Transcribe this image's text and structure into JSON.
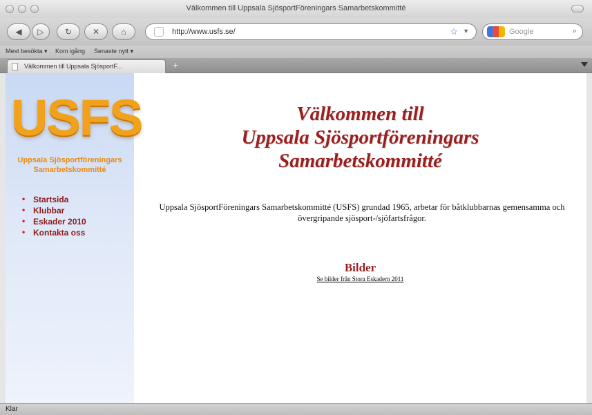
{
  "window": {
    "title": "Välkommen till Uppsala SjösportFöreningars Samarbetskommitté"
  },
  "toolbar": {
    "back_icon": "back-arrow-icon",
    "forward_icon": "forward-arrow-icon",
    "reload_icon": "reload-icon",
    "stop_icon": "stop-icon",
    "home_icon": "home-icon",
    "url": "http://www.usfs.se/",
    "search_placeholder": "Google"
  },
  "bookmarks": {
    "items": [
      "Mest besökta ▾",
      "Kom igång",
      "Senaste nytt ▾"
    ]
  },
  "tabs": [
    {
      "label": "Välkommen till Uppsala SjösportF..."
    }
  ],
  "sidebar": {
    "logo_text": "USFS",
    "logo_sub_line1": "Uppsala Sjösportföreningars",
    "logo_sub_line2": "Samarbetskommitté",
    "nav": [
      "Startsida",
      "Klubbar",
      "Eskader 2010",
      "Kontakta oss"
    ]
  },
  "main": {
    "heading_line1": "Välkommen till",
    "heading_line2": "Uppsala Sjösportföreningars",
    "heading_line3": "Samarbetskommitté",
    "intro": "Uppsala SjösportFöreningars Samarbetskommitté (USFS) grundad 1965, arbetar för båtklubbarnas gemensamma och övergripande sjösport-/sjöfartsfrågor.",
    "bilder_title": "Bilder",
    "bilder_link": "Se bilder från Stora Eskadern 2011"
  },
  "status": {
    "text": "Klar"
  },
  "colors": {
    "heading": "#9b1f1f",
    "nav_link": "#8b1c1c",
    "logo": "#f2a21a"
  }
}
